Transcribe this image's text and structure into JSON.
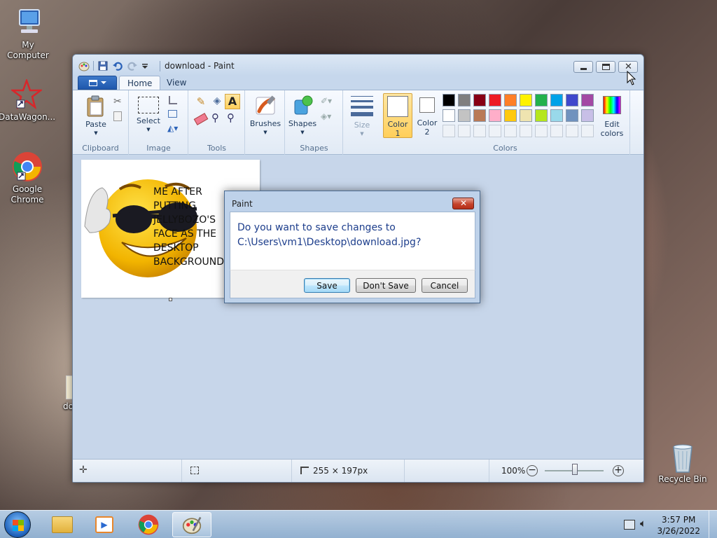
{
  "desktop": {
    "icons": [
      {
        "label": "My Computer"
      },
      {
        "label": "DataWagon..."
      },
      {
        "label": "Google Chrome"
      },
      {
        "label": "do"
      },
      {
        "label": "Recycle Bin"
      }
    ]
  },
  "window": {
    "title": "download - Paint",
    "tabs": {
      "home": "Home",
      "view": "View"
    },
    "ribbon": {
      "groups": {
        "clipboard": "Clipboard",
        "image": "Image",
        "tools": "Tools",
        "shapes": "Shapes",
        "colors": "Colors"
      },
      "buttons": {
        "paste": "Paste",
        "select": "Select",
        "brushes": "Brushes",
        "shapes": "Shapes",
        "size": "Size",
        "color1_line1": "Color",
        "color1_line2": "1",
        "color2_line1": "Color",
        "color2_line2": "2",
        "edit_colors_line1": "Edit",
        "edit_colors_line2": "colors"
      },
      "palette_row1": [
        "#000000",
        "#7f7f7f",
        "#880015",
        "#ed1c24",
        "#ff7f27",
        "#fff200",
        "#22b14c",
        "#00a2e8",
        "#3f48cc",
        "#a349a4"
      ],
      "palette_row2": [
        "#ffffff",
        "#c3c3c3",
        "#b97a57",
        "#ffaec9",
        "#ffc90e",
        "#efe4b0",
        "#b5e61d",
        "#99d9ea",
        "#7092be",
        "#c8bfe7"
      ]
    },
    "canvas": {
      "meme_lines": [
        "ME AFTER",
        "PUTTING",
        "JELLYBOZO'S",
        "FACE AS THE",
        "DESKTOP",
        "BACKGROUND"
      ]
    },
    "status": {
      "dimensions": "255 × 197px",
      "zoom": "100%"
    }
  },
  "dialog": {
    "title": "Paint",
    "message_line1": "Do you want to save changes to",
    "message_line2": "C:\\Users\\vm1\\Desktop\\download.jpg?",
    "save": "Save",
    "dont_save": "Don't Save",
    "cancel": "Cancel"
  },
  "taskbar": {
    "time": "3:57 PM",
    "date": "3/26/2022"
  }
}
